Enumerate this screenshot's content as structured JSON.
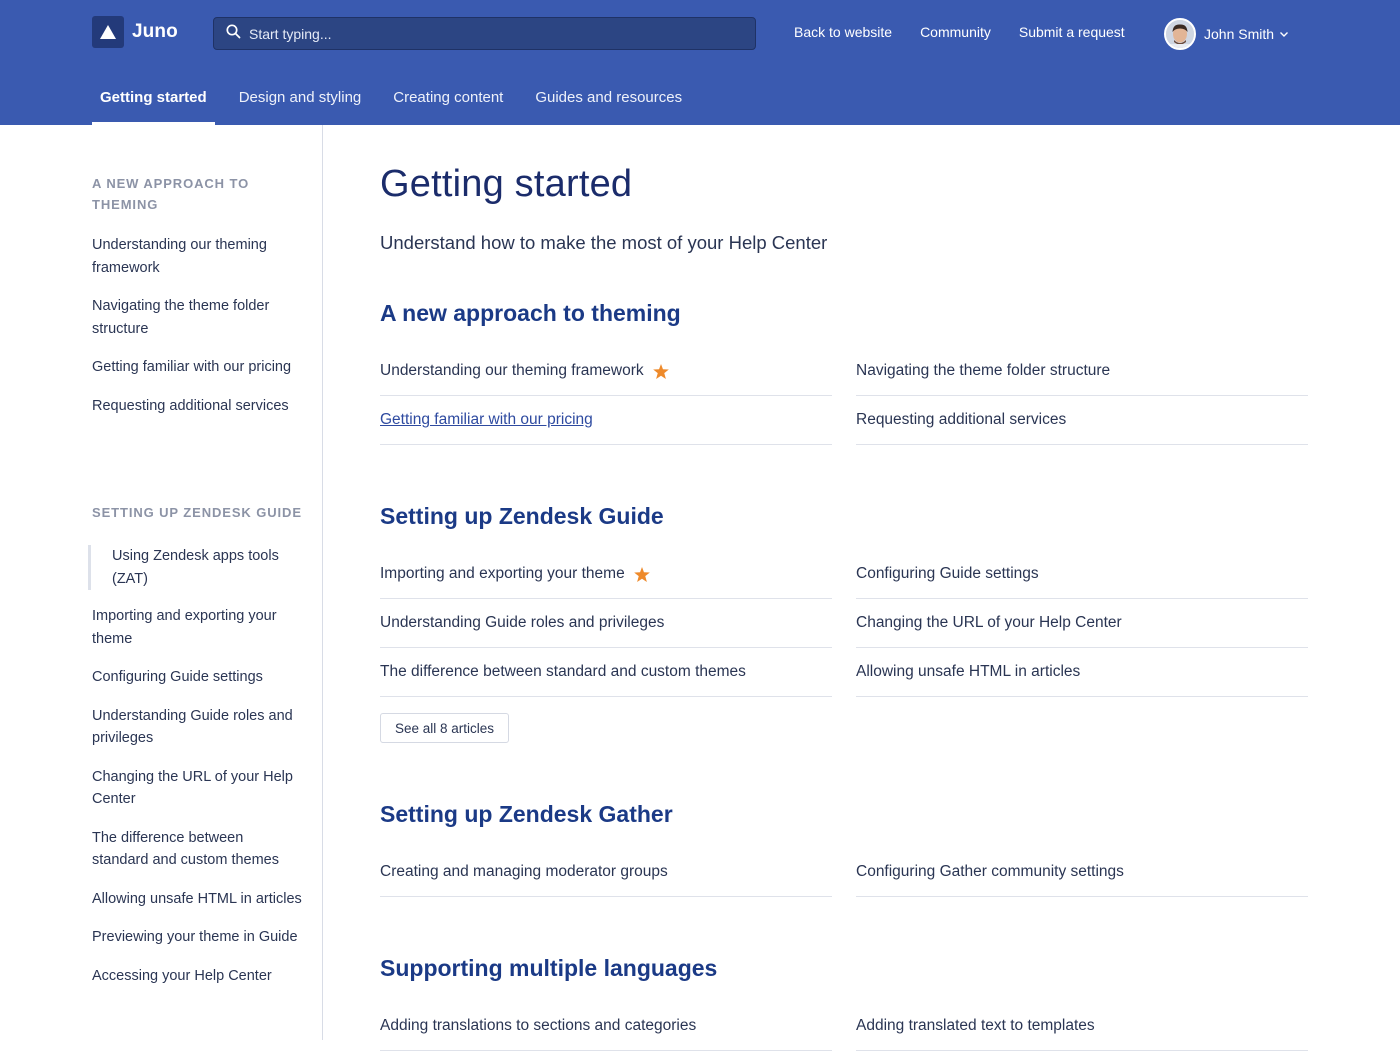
{
  "brand": {
    "name": "Juno",
    "logo_icon": "triangle-logo-icon"
  },
  "search": {
    "placeholder": "Start typing..."
  },
  "header_links": [
    "Back to website",
    "Community",
    "Submit a request"
  ],
  "user": {
    "name": "John Smith"
  },
  "nav_tabs": [
    {
      "label": "Getting started",
      "active": true
    },
    {
      "label": "Design and styling",
      "active": false
    },
    {
      "label": "Creating content",
      "active": false
    },
    {
      "label": "Guides and resources",
      "active": false
    }
  ],
  "sidebar": {
    "groups": [
      {
        "heading": "A NEW APPROACH TO THEMING",
        "items": [
          "Understanding our theming framework",
          "Navigating the theme folder structure",
          "Getting familiar with our pricing",
          "Requesting additional services"
        ]
      },
      {
        "heading": "SETTING UP ZENDESK GUIDE",
        "items": [
          "Using Zendesk apps tools (ZAT)",
          "Importing and exporting your theme",
          "Configuring Guide settings",
          "Understanding Guide roles and privileges",
          "Changing the URL of your Help Center",
          "The difference between standard and custom themes",
          "Allowing unsafe HTML in articles",
          "Previewing your theme in Guide",
          "Accessing your Help Center"
        ],
        "current_item": "Using Zendesk apps tools (ZAT)"
      }
    ]
  },
  "main": {
    "title": "Getting started",
    "subtitle": "Understand how to make the most of your Help Center",
    "sections": [
      {
        "title": "A new approach to theming",
        "articles": [
          {
            "title": "Understanding our theming framework",
            "promoted": true
          },
          {
            "title": "Navigating the theme folder structure",
            "promoted": false
          },
          {
            "title": "Getting familiar with our pricing",
            "promoted": false,
            "hovered_link": true
          },
          {
            "title": "Requesting additional services",
            "promoted": false
          }
        ]
      },
      {
        "title": "Setting up Zendesk Guide",
        "articles": [
          {
            "title": "Importing and exporting your theme",
            "promoted": true
          },
          {
            "title": "Configuring Guide settings",
            "promoted": false
          },
          {
            "title": "Understanding Guide roles and privileges",
            "promoted": false
          },
          {
            "title": "Changing the URL of your Help Center",
            "promoted": false
          },
          {
            "title": "The difference between standard and custom themes",
            "promoted": false
          },
          {
            "title": "Allowing unsafe HTML in articles",
            "promoted": false
          }
        ],
        "see_all_label": "See all 8 articles"
      },
      {
        "title": "Setting up Zendesk Gather",
        "articles": [
          {
            "title": "Creating and managing moderator groups",
            "promoted": false
          },
          {
            "title": "Configuring Gather community settings",
            "promoted": false
          }
        ]
      },
      {
        "title": "Supporting multiple languages",
        "articles": [
          {
            "title": "Adding translations to sections and categories",
            "promoted": false
          },
          {
            "title": "Adding translated text to templates",
            "promoted": false
          }
        ]
      }
    ]
  },
  "colors": {
    "header_bg": "#3a5ab0",
    "search_bg": "#2c4583",
    "title_text": "#1b2c6b",
    "section_title": "#1b3a86",
    "star": "#ee8a2b",
    "link": "#2e4aa0"
  }
}
